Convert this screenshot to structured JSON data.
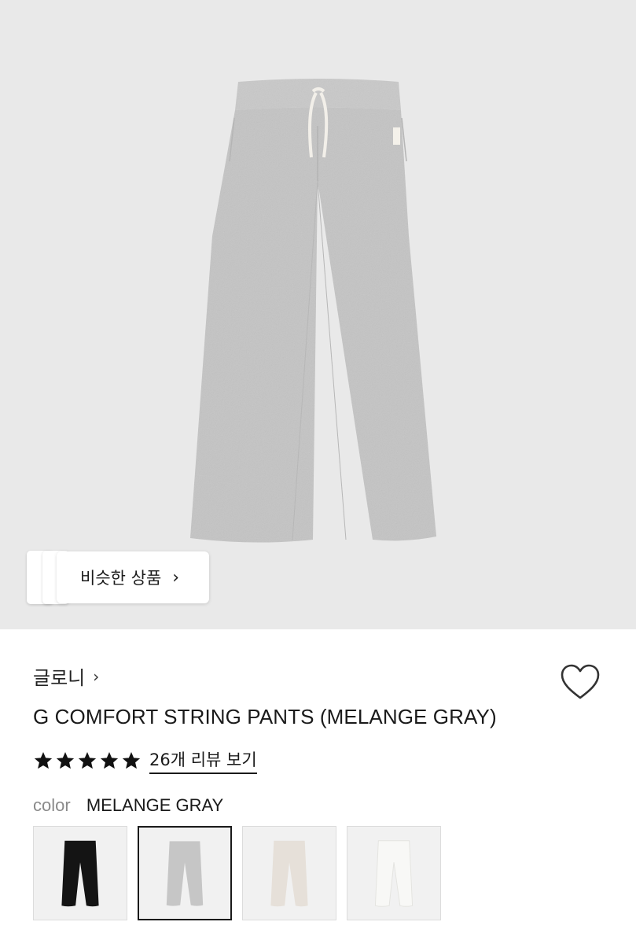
{
  "similar_products": {
    "label": "비슷한 상품",
    "chevron": "›"
  },
  "brand": {
    "name": "글로니",
    "chevron": "›"
  },
  "wishlist": {
    "icon": "heart-outline-icon"
  },
  "product": {
    "title": "G COMFORT STRING PANTS (MELANGE GRAY)"
  },
  "rating": {
    "stars": 5,
    "max_stars": 5,
    "review_link": "26개 리뷰 보기"
  },
  "color": {
    "label": "color",
    "value": "MELANGE GRAY"
  },
  "swatches": [
    {
      "name": "black",
      "fill": "#141414",
      "selected": false
    },
    {
      "name": "melange-gray",
      "fill": "#c6c6c6",
      "selected": true
    },
    {
      "name": "beige",
      "fill": "#e6e0d9",
      "selected": false
    },
    {
      "name": "white",
      "fill": "#f8f8f6",
      "selected": false
    }
  ]
}
